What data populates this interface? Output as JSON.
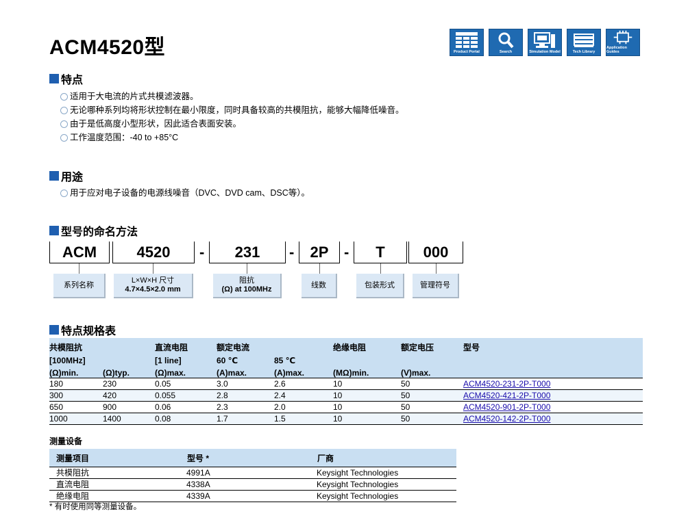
{
  "title": "ACM4520型",
  "nav_icons": [
    {
      "label": "Product Portal",
      "icon": "product-portal-icon"
    },
    {
      "label": "Search",
      "icon": "search-icon"
    },
    {
      "label": "Simulation Model",
      "icon": "simulation-model-icon"
    },
    {
      "label": "Tech Library",
      "icon": "tech-library-icon"
    },
    {
      "label": "Application Guides",
      "icon": "application-guides-icon"
    }
  ],
  "features": {
    "heading": "特点",
    "items": [
      "适用于大电流的片式共模滤波器。",
      "无论哪种系列均将形状控制在最小限度，同时具备较高的共模阻抗，能够大幅降低噪音。",
      "由于是低高度小型形状，因此适合表面安装。",
      "工作温度范围：-40 to +85°C"
    ]
  },
  "usage": {
    "heading": "用途",
    "items": [
      "用于应对电子设备的电源线噪音（DVC、DVD cam、DSC等）。"
    ]
  },
  "naming": {
    "heading": "型号的命名方法",
    "parts": [
      "ACM",
      "4520",
      "231",
      "2P",
      "T",
      "000"
    ],
    "dash": "-",
    "labels": [
      {
        "line1": "系列名称",
        "line2": ""
      },
      {
        "line1": "L×W×H 尺寸",
        "line2": "4.7×4.5×2.0 mm"
      },
      {
        "line1": "阻抗",
        "line2": "(Ω) at 100MHz"
      },
      {
        "line1": "线数",
        "line2": ""
      },
      {
        "line1": "包装形式",
        "line2": ""
      },
      {
        "line1": "管理符号",
        "line2": ""
      }
    ]
  },
  "spec": {
    "heading": "特点规格表",
    "header_row1": [
      "共模阻抗",
      "",
      "直流电阻",
      "额定电流",
      "",
      "绝缘电阻",
      "额定电压",
      "型号"
    ],
    "header_row2": [
      "[100MHz]",
      "",
      "[1 line]",
      "60 ℃",
      "85 ℃",
      "",
      "",
      ""
    ],
    "header_row3": [
      "(Ω)min.",
      "(Ω)typ.",
      "(Ω)max.",
      "(A)max.",
      "(A)max.",
      "(MΩ)min.",
      "(V)max.",
      ""
    ],
    "rows": [
      [
        "180",
        "230",
        "0.05",
        "3.0",
        "2.6",
        "10",
        "50",
        "ACM4520-231-2P-T000"
      ],
      [
        "300",
        "420",
        "0.055",
        "2.8",
        "2.4",
        "10",
        "50",
        "ACM4520-421-2P-T000"
      ],
      [
        "650",
        "900",
        "0.06",
        "2.3",
        "2.0",
        "10",
        "50",
        "ACM4520-901-2P-T000"
      ],
      [
        "1000",
        "1400",
        "0.08",
        "1.7",
        "1.5",
        "10",
        "50",
        "ACM4520-142-2P-T000"
      ]
    ]
  },
  "measurement": {
    "heading": "测量设备",
    "headers": [
      "测量项目",
      "型号 *",
      "厂商"
    ],
    "rows": [
      [
        "共模阻抗",
        "4991A",
        "Keysight Technologies"
      ],
      [
        "直流电阻",
        "4338A",
        "Keysight Technologies"
      ],
      [
        "绝缘电阻",
        "4339A",
        "Keysight Technologies"
      ]
    ],
    "note": "*  有时使用同等测量设备。"
  }
}
